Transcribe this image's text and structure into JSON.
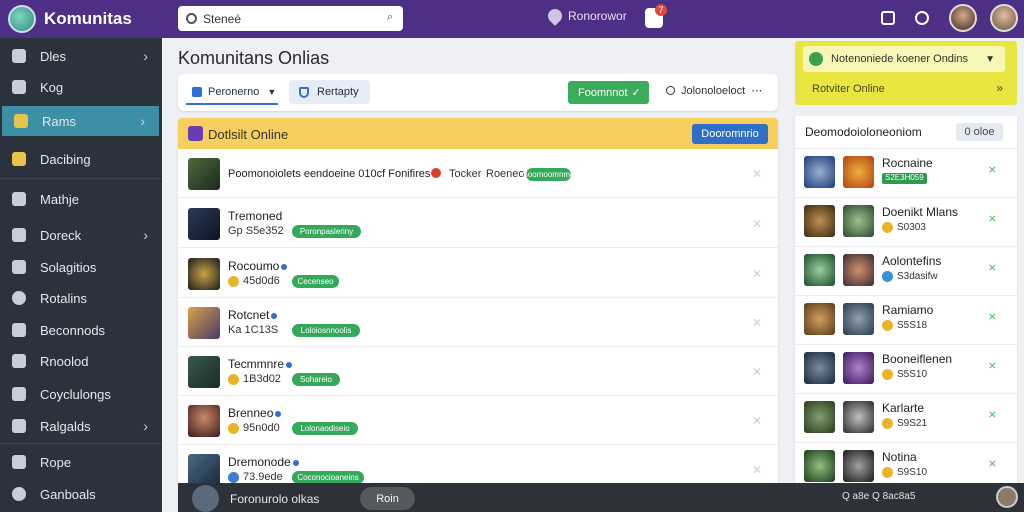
{
  "app": {
    "title": "Komunitas"
  },
  "search": {
    "value": "Steneé"
  },
  "topbar": {
    "location": "Ronorowor",
    "notification_count": "7"
  },
  "colors": {
    "topbar": "#4d2f86",
    "sidebar": "#2c323c",
    "accent": "#3c8fa4",
    "green": "#3cab5b",
    "yellow": "#f6cf5e"
  },
  "sidebar": {
    "items": [
      {
        "label": "Dles",
        "icon": "speech-icon",
        "chevron": "›"
      },
      {
        "label": "Kog",
        "icon": "camera-icon",
        "chevron": ""
      },
      {
        "label": "Rams",
        "icon": "ram-icon",
        "chevron": "›",
        "active": true
      },
      {
        "label": "Dacibing",
        "icon": "controller-icon",
        "chevron": ""
      },
      {
        "label": "Mathje",
        "icon": "brush-icon",
        "chevron": ""
      },
      {
        "label": "Doreck",
        "icon": "users-icon",
        "chevron": "›"
      },
      {
        "label": "Solagitios",
        "icon": "user-icon",
        "chevron": ""
      },
      {
        "label": "Rotalins",
        "icon": "gear-icon",
        "chevron": ""
      },
      {
        "label": "Beconnods",
        "icon": "chat-icon",
        "chevron": ""
      },
      {
        "label": "Rnoolod",
        "icon": "monitor-icon",
        "chevron": ""
      },
      {
        "label": "Coyclulongs",
        "icon": "pen-icon",
        "chevron": ""
      },
      {
        "label": "Ralgalds",
        "icon": "chart-icon",
        "chevron": "›"
      },
      {
        "label": "Rope",
        "icon": "calendar-icon",
        "chevron": ""
      },
      {
        "label": "Ganboals",
        "icon": "info-icon",
        "chevron": ""
      }
    ]
  },
  "main": {
    "title": "Komunitans Onlias",
    "toolbar": {
      "select": "Peronerno",
      "button_light": "Rertapty",
      "button_green": "Foomnnot",
      "more": "Jolonoloeloct"
    },
    "list": {
      "header": "Dotlsilt Online",
      "header_button": "Dooromnrio",
      "rows": [
        {
          "name": "Poomonoiolets eendoeine 010cf Fonifires",
          "extra": "Tocker",
          "extra2": "Roeneo",
          "pill": "Soomoomnmo",
          "meta": "",
          "layout": "single"
        },
        {
          "name": "Tremoned",
          "meta": "Gp S5e352",
          "pill": "Poronpasleriny",
          "dot": false
        },
        {
          "name": "Rocoumo",
          "meta": "45d0d6",
          "pill": "Cecenseo",
          "dot": true
        },
        {
          "name": "Rotcnet",
          "meta": "Ka 1C13S",
          "pill": "Loloiosnnoolis",
          "dot": true
        },
        {
          "name": "Tecmmnre",
          "meta": "1B3d02",
          "pill": "Sohareio",
          "dot": true
        },
        {
          "name": "Brenneo",
          "meta": "95n0d0",
          "pill": "Lolonaodiseio",
          "dot": true
        },
        {
          "name": "Dremonode",
          "meta": "73.9ede",
          "pill": "Coconocioaneins",
          "dot": true
        }
      ]
    }
  },
  "alert": {
    "text": "Notenoniede koener Ondins",
    "sub": "Rotviter Online"
  },
  "friends": {
    "title": "Deomodoioloneoniom",
    "button": "0 oloe",
    "rows": [
      {
        "name": "Rocnaine",
        "meta": "S2E3H059",
        "tag": true
      },
      {
        "name": "Doenikt Mlans",
        "meta": "S0303",
        "tag": false
      },
      {
        "name": "Aolontefins",
        "meta": "S3dasifw",
        "tag": false
      },
      {
        "name": "Ramiamo",
        "meta": "S5S18",
        "tag": false
      },
      {
        "name": "Booneiflenen",
        "meta": "S5S10",
        "tag": false
      },
      {
        "name": "Karlarte",
        "meta": "S9S21",
        "tag": false
      },
      {
        "name": "Notina",
        "meta": "S9S10",
        "tag": false
      }
    ]
  },
  "bottombar": {
    "label": "Foronurolo olkas",
    "button": "Roin",
    "status": "Q a8e Q 8ac8a5"
  }
}
